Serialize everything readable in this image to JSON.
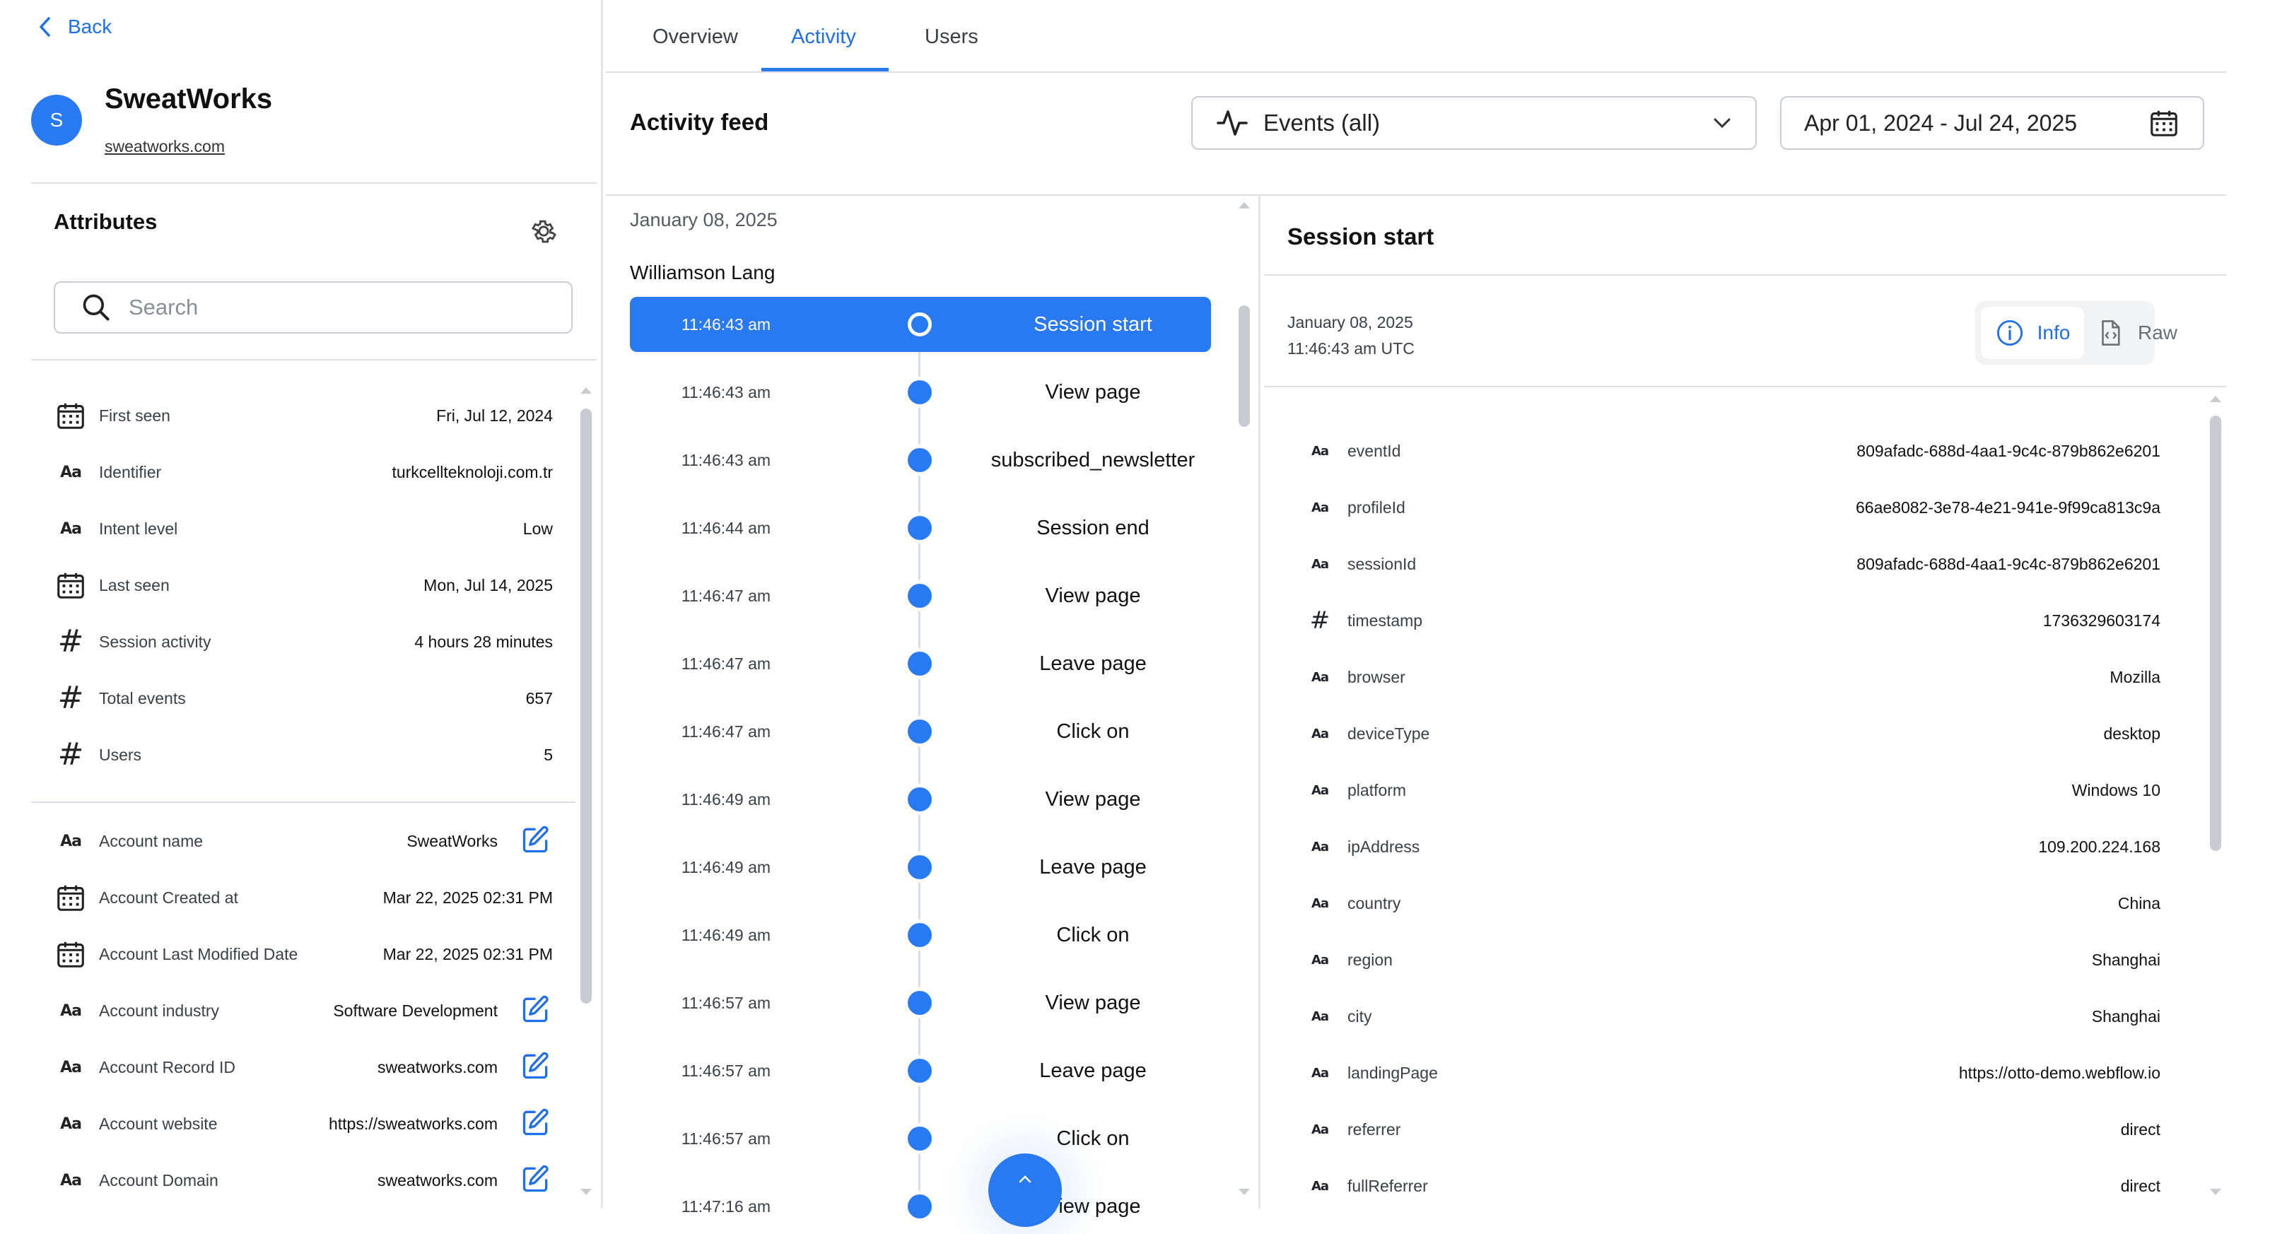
{
  "nav": {
    "back_label": "Back"
  },
  "account": {
    "avatar_letter": "S",
    "name": "SweatWorks",
    "domain": "sweatworks.com"
  },
  "attributes": {
    "title": "Attributes",
    "search_placeholder": "Search",
    "items": [
      {
        "icon": "calendar-icon",
        "label": "First seen",
        "value": "Fri, Jul 12, 2024"
      },
      {
        "icon": "text-type-icon",
        "label": "Identifier",
        "value": "turkcellteknoloji.com.tr"
      },
      {
        "icon": "text-type-icon",
        "label": "Intent level",
        "value": "Low"
      },
      {
        "icon": "calendar-icon",
        "label": "Last seen",
        "value": "Mon, Jul 14, 2025"
      },
      {
        "icon": "number-type-icon",
        "label": "Session activity",
        "value": "4 hours 28 minutes"
      },
      {
        "icon": "number-type-icon",
        "label": "Total events",
        "value": "657"
      },
      {
        "icon": "number-type-icon",
        "label": "Users",
        "value": "5"
      }
    ],
    "account_items": [
      {
        "icon": "text-type-icon",
        "label": "Account name",
        "value": "SweatWorks",
        "editable": true
      },
      {
        "icon": "calendar-icon",
        "label": "Account Created at",
        "value": "Mar 22, 2025 02:31 PM",
        "editable": false
      },
      {
        "icon": "calendar-icon",
        "label": "Account Last Modified Date",
        "value": "Mar 22, 2025 02:31 PM",
        "editable": false
      },
      {
        "icon": "text-type-icon",
        "label": "Account industry",
        "value": "Software Development",
        "editable": true
      },
      {
        "icon": "text-type-icon",
        "label": "Account Record ID",
        "value": "sweatworks.com",
        "editable": true
      },
      {
        "icon": "text-type-icon",
        "label": "Account website",
        "value": "https://sweatworks.com",
        "editable": true
      },
      {
        "icon": "text-type-icon",
        "label": "Account Domain",
        "value": "sweatworks.com",
        "editable": true
      }
    ]
  },
  "tabs": [
    {
      "label": "Overview",
      "active": false
    },
    {
      "label": "Activity",
      "active": true
    },
    {
      "label": "Users",
      "active": false
    }
  ],
  "feed": {
    "title": "Activity feed",
    "event_filter": "Events (all)",
    "date_range": "Apr 01, 2024 - Jul 24, 2025",
    "date_group": "January 08, 2025",
    "user": "Williamson Lang",
    "events": [
      {
        "time": "11:46:43 am",
        "name": "Session start",
        "selected": true
      },
      {
        "time": "11:46:43 am",
        "name": "View page"
      },
      {
        "time": "11:46:43 am",
        "name": "subscribed_newsletter"
      },
      {
        "time": "11:46:44 am",
        "name": "Session end"
      },
      {
        "time": "11:46:47 am",
        "name": "View page"
      },
      {
        "time": "11:46:47 am",
        "name": "Leave page"
      },
      {
        "time": "11:46:47 am",
        "name": "Click on"
      },
      {
        "time": "11:46:49 am",
        "name": "View page"
      },
      {
        "time": "11:46:49 am",
        "name": "Leave page"
      },
      {
        "time": "11:46:49 am",
        "name": "Click on"
      },
      {
        "time": "11:46:57 am",
        "name": "View page"
      },
      {
        "time": "11:46:57 am",
        "name": "Leave page"
      },
      {
        "time": "11:46:57 am",
        "name": "Click on"
      },
      {
        "time": "11:47:16 am",
        "name": "View page"
      }
    ]
  },
  "detail": {
    "title": "Session start",
    "date": "January 08, 2025",
    "time": "11:46:43 am UTC",
    "view_info": "Info",
    "view_raw": "Raw",
    "properties": [
      {
        "type": "text",
        "key": "eventId",
        "value": "809afadc-688d-4aa1-9c4c-879b862e6201"
      },
      {
        "type": "text",
        "key": "profileId",
        "value": "66ae8082-3e78-4e21-941e-9f99ca813c9a"
      },
      {
        "type": "text",
        "key": "sessionId",
        "value": "809afadc-688d-4aa1-9c4c-879b862e6201"
      },
      {
        "type": "number",
        "key": "timestamp",
        "value": "1736329603174"
      },
      {
        "type": "text",
        "key": "browser",
        "value": "Mozilla"
      },
      {
        "type": "text",
        "key": "deviceType",
        "value": "desktop"
      },
      {
        "type": "text",
        "key": "platform",
        "value": "Windows 10"
      },
      {
        "type": "text",
        "key": "ipAddress",
        "value": "109.200.224.168"
      },
      {
        "type": "text",
        "key": "country",
        "value": "China"
      },
      {
        "type": "text",
        "key": "region",
        "value": "Shanghai"
      },
      {
        "type": "text",
        "key": "city",
        "value": "Shanghai"
      },
      {
        "type": "text",
        "key": "landingPage",
        "value": "https://otto-demo.webflow.io"
      },
      {
        "type": "text",
        "key": "referrer",
        "value": "direct"
      },
      {
        "type": "text",
        "key": "fullReferrer",
        "value": "direct"
      }
    ]
  },
  "colors": {
    "accent": "#2979f2",
    "link": "#1f6feb",
    "border": "#dcdfe3"
  }
}
